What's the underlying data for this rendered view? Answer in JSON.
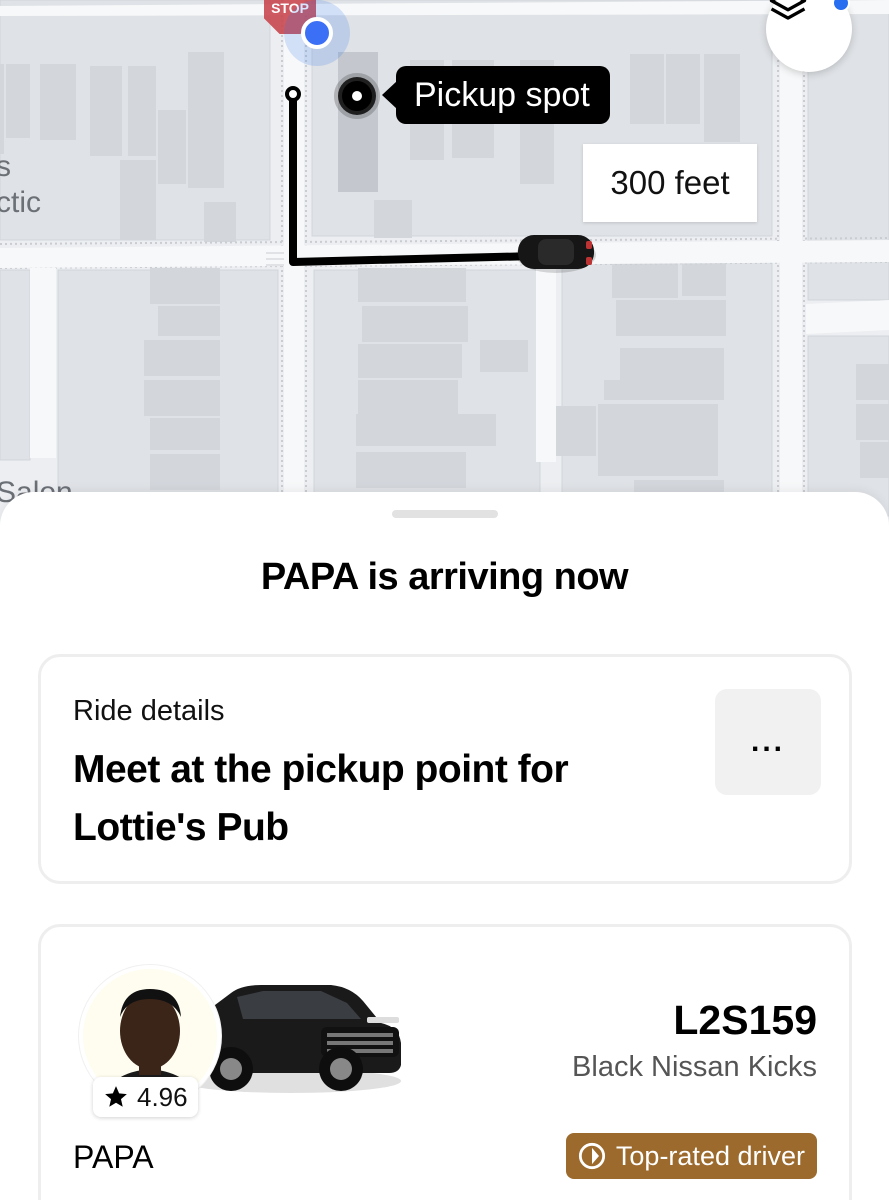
{
  "map": {
    "stop_sign_text": "STOP",
    "pickup_label": "Pickup spot",
    "distance_label": "300 feet",
    "street_fragments": [
      "s",
      "ctic",
      "Salon"
    ],
    "layers_icon": "layers-icon"
  },
  "sheet": {
    "title": "PAPA is arriving now",
    "ride_details": {
      "eyebrow": "Ride details",
      "instruction": "Meet at the pickup point for Lottie's Pub",
      "more_label": "..."
    },
    "driver": {
      "name": "PAPA",
      "rating": "4.96",
      "plate": "L2S159",
      "vehicle": "Black Nissan Kicks",
      "badge": "Top-rated driver"
    }
  },
  "colors": {
    "accent_blue": "#276ef1",
    "badge_brown": "#9b6a2c",
    "map_background": "#eceef1"
  }
}
